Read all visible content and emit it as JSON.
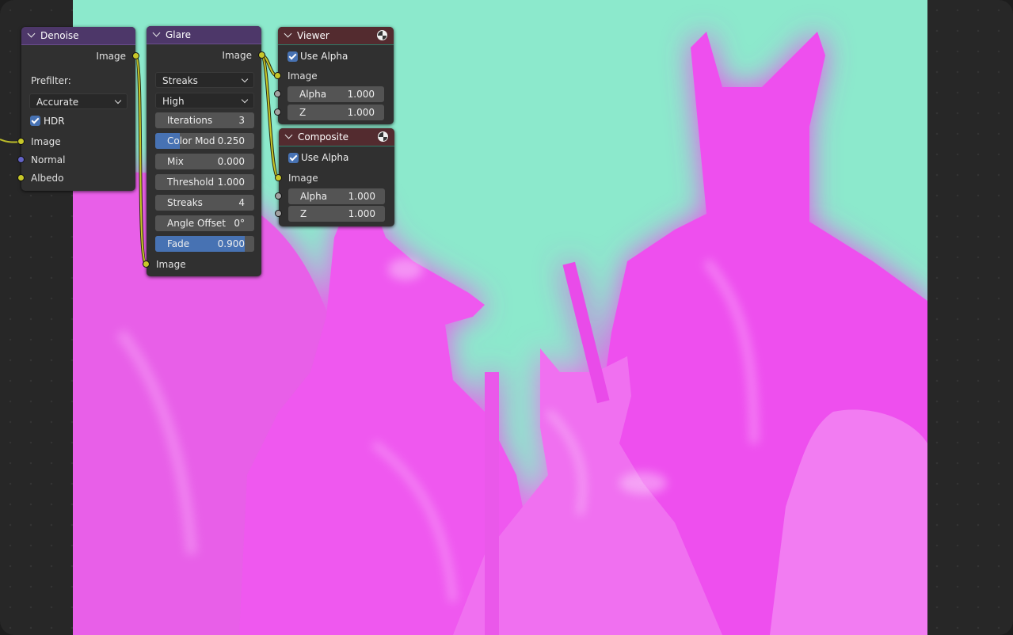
{
  "colors": {
    "filter_header": "#4d3769",
    "output_header": "#532b2f",
    "node_body": "#303030",
    "socket_image": "#c7c729",
    "socket_value": "#a1a1a1",
    "socket_vector": "#6363c7",
    "slider_fill": "#4772b3",
    "backdrop_bg": "#8ce9cc",
    "backdrop_subject": "#ee44ee"
  },
  "nodes": {
    "denoise": {
      "title": "Denoise",
      "output_image": "Image",
      "prefilter_label": "Prefilter:",
      "prefilter_value": "Accurate",
      "hdr_label": "HDR",
      "hdr_checked": true,
      "inputs": [
        "Image",
        "Normal",
        "Albedo"
      ]
    },
    "glare": {
      "title": "Glare",
      "output_image": "Image",
      "glare_type": "Streaks",
      "quality": "High",
      "iterations": {
        "label": "Iterations",
        "value": "3"
      },
      "color_mod": {
        "label": "Color Mod",
        "value": "0.250",
        "fraction": 0.25
      },
      "mix": {
        "label": "Mix",
        "value": "0.000"
      },
      "threshold": {
        "label": "Threshold",
        "value": "1.000"
      },
      "streaks": {
        "label": "Streaks",
        "value": "4"
      },
      "angle_offset": {
        "label": "Angle Offset",
        "value": "0°"
      },
      "fade": {
        "label": "Fade",
        "value": "0.900",
        "fraction": 0.9
      },
      "input_image": "Image"
    },
    "viewer": {
      "title": "Viewer",
      "use_alpha_label": "Use Alpha",
      "use_alpha_checked": true,
      "input_image": "Image",
      "alpha": {
        "label": "Alpha",
        "value": "1.000"
      },
      "z": {
        "label": "Z",
        "value": "1.000"
      }
    },
    "composite": {
      "title": "Composite",
      "use_alpha_label": "Use Alpha",
      "use_alpha_checked": true,
      "input_image": "Image",
      "alpha": {
        "label": "Alpha",
        "value": "1.000"
      },
      "z": {
        "label": "Z",
        "value": "1.000"
      }
    }
  }
}
